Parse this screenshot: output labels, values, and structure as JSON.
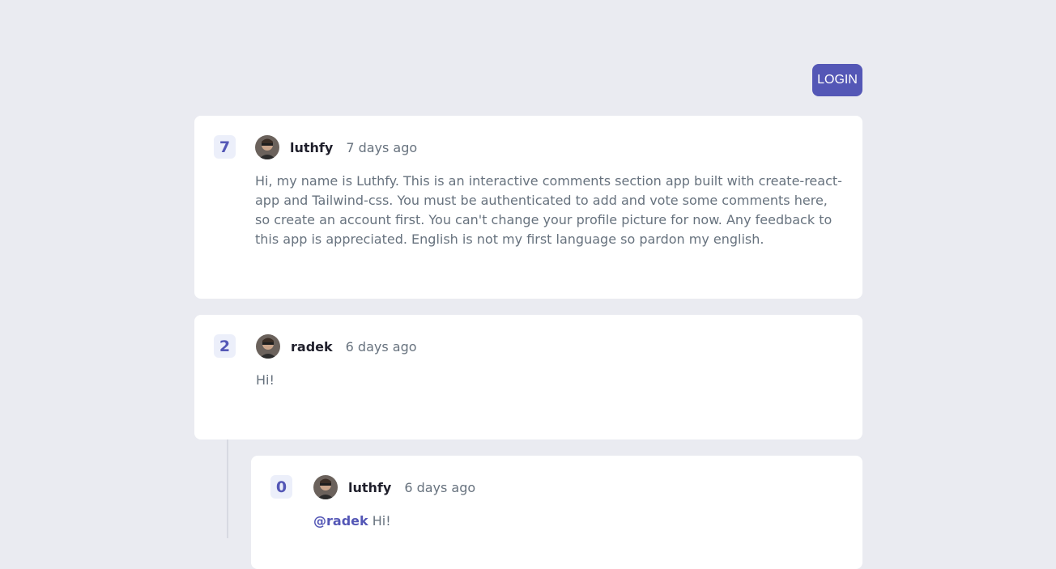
{
  "header": {
    "login_label": "LOGIN"
  },
  "comments": [
    {
      "score": "7",
      "username": "luthfy",
      "time": "7 days ago",
      "text": "Hi, my name is Luthfy. This is an interactive comments section app built with create-react-app and Tailwind-css. You must be authenticated to add and vote some comments here, so create an account first. You can't change your profile picture for now. Any feedback to this app is appreciated. English is not my first language so pardon my english."
    },
    {
      "score": "2",
      "username": "radek",
      "time": "6 days ago",
      "text": "Hi!"
    }
  ],
  "replies": [
    {
      "score": "0",
      "username": "luthfy",
      "time": "6 days ago",
      "mention": "@radek",
      "text": "Hi!"
    }
  ],
  "colors": {
    "accent": "#5457b6",
    "background": "#eaebf1",
    "text_muted": "#67727e"
  },
  "icons": {
    "avatar": "avatar-icon"
  }
}
